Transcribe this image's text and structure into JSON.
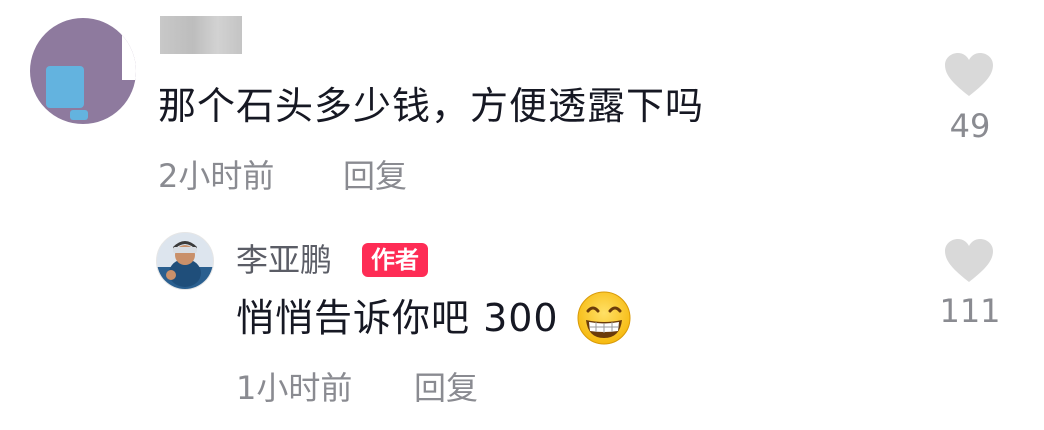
{
  "comment": {
    "text": "那个石头多少钱，方便透露下吗",
    "time": "2小时前",
    "reply_label": "回复",
    "like_count": "49"
  },
  "reply": {
    "author": "李亚鹏",
    "author_badge": "作者",
    "text": "悄悄告诉你吧 300",
    "emoji": "grinning-face-emoji",
    "time": "1小时前",
    "reply_label": "回复",
    "like_count": "111"
  },
  "colors": {
    "badge_bg": "#fe2c55",
    "meta_text": "#8a8b91",
    "main_text": "#161823",
    "heart": "#d9d9d9"
  }
}
